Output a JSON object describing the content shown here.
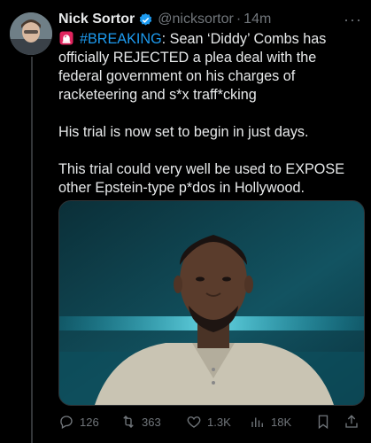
{
  "post": {
    "author_name": "Nick Sortor",
    "handle": "@nicksortor",
    "separator": "·",
    "time": "14m",
    "more": "···",
    "hashtag": "#BREAKING",
    "line1_rest": ": Sean ‘Diddy’ Combs has officially REJECTED a plea deal with the federal government on his charges of racketeering and s*x traff*cking",
    "paragraph2": "His trial is now set to begin in just days.",
    "paragraph3": "This trial could very well be used to EXPOSE other Epstein-type p*dos in Hollywood."
  },
  "actions": {
    "replies": "126",
    "reposts": "363",
    "likes": "1.3K",
    "views": "18K"
  },
  "colors": {
    "background": "#000000",
    "text": "#e7e9ea",
    "secondary": "#71767b",
    "accent": "#1d9bf0"
  },
  "icons": [
    "verified-badge-icon",
    "siren-icon",
    "reply-icon",
    "repost-icon",
    "like-icon",
    "views-icon",
    "bookmark-icon",
    "share-icon"
  ]
}
